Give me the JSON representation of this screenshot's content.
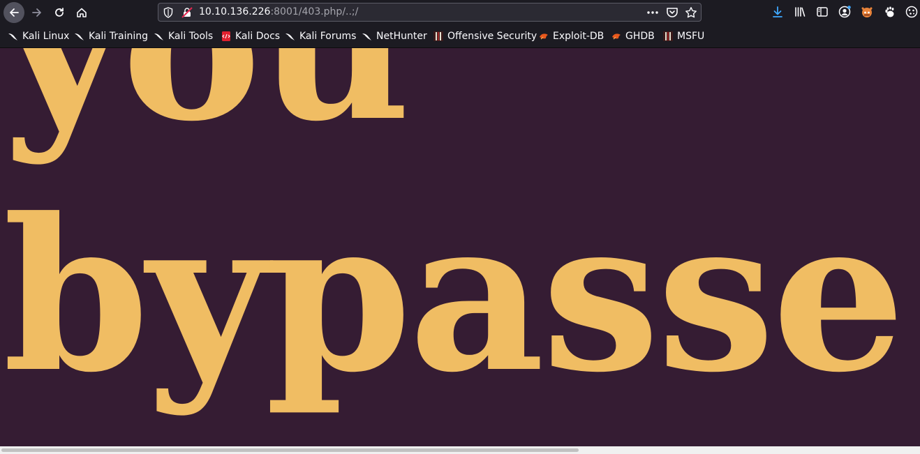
{
  "browser": {
    "url_host": "10.10.136.226",
    "url_rest": ":8001/403.php/..;/",
    "icons": {
      "back": "back-arrow-icon",
      "forward": "forward-arrow-icon",
      "reload": "reload-icon",
      "home": "home-icon",
      "shield": "tracking-protection-shield-icon",
      "insecure": "insecure-connection-icon",
      "page_actions": "more-dots-icon",
      "pocket": "pocket-icon",
      "bookmark_star": "star-icon",
      "downloads": "download-icon",
      "library": "library-icon",
      "sidebar": "sidebar-icon",
      "account": "account-icon",
      "extension1": "fox-extension-icon",
      "extension2": "gnome-extension-icon",
      "extension3": "cookie-extension-icon"
    }
  },
  "bookmarks": [
    {
      "label": "Kali Linux",
      "icon": "kali-dragon-icon"
    },
    {
      "label": "Kali Training",
      "icon": "kali-dragon-icon"
    },
    {
      "label": "Kali Tools",
      "icon": "kali-dragon-icon"
    },
    {
      "label": "Kali Docs",
      "icon": "kali-docs-icon"
    },
    {
      "label": "Kali Forums",
      "icon": "kali-dragon-icon"
    },
    {
      "label": "NetHunter",
      "icon": "kali-dragon-icon"
    },
    {
      "label": "Offensive Security",
      "icon": "offsec-icon"
    },
    {
      "label": "Exploit-DB",
      "icon": "exploit-db-icon"
    },
    {
      "label": "GHDB",
      "icon": "exploit-db-icon"
    },
    {
      "label": "MSFU",
      "icon": "offsec-icon"
    }
  ],
  "page": {
    "line1": "you",
    "line2": "bypasse"
  },
  "colors": {
    "page_background": "#351c33",
    "heading_text": "#f0bd63",
    "toolbar": "#1c1b22",
    "download_accent": "#3fa9ff"
  }
}
